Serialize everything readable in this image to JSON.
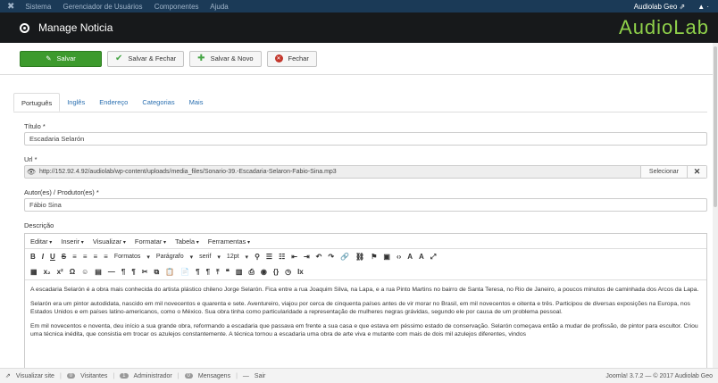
{
  "topnav": {
    "menu": [
      "Sistema",
      "Gerenciador de Usuários",
      "Componentes",
      "Ajuda"
    ],
    "user": "Audiolab Geo ⇗",
    "user2": "▲ ·"
  },
  "header": {
    "title": "Manage Noticia",
    "brand": "AudioLab"
  },
  "toolbar": {
    "save": "Salvar",
    "save_close": "Salvar & Fechar",
    "save_new": "Salvar & Novo",
    "close": "Fechar"
  },
  "tabs": [
    "Português",
    "Inglês",
    "Endereço",
    "Categorias",
    "Mais"
  ],
  "form": {
    "titulo_label": "Título *",
    "titulo_value": "Escadaria Selarón",
    "url_label": "Url *",
    "url_value": "http://152.92.4.92/audiolab/wp-content/uploads/media_files/Sonario-39.-Escadaria-Selaron-Fabio-Sina.mp3",
    "select_label": "Selecionar",
    "autor_label": "Autor(es) / Produtor(es) *",
    "autor_value": "Fábio Sina",
    "descricao_label": "Descrição"
  },
  "editor": {
    "menu": [
      "Editar",
      "Inserir",
      "Visualizar",
      "Formatar",
      "Tabela",
      "Ferramentas"
    ],
    "formats": "Formatos",
    "paragraph": "Parágrafo",
    "font": "serif",
    "size": "12pt",
    "paragraphs": [
      "A escadaria Selarón é a obra mais conhecida do artista plástico chileno Jorge Selarón. Fica entre a rua Joaquim Silva, na Lapa, e a rua Pinto Martins no bairro de Santa Teresa, no Rio de Janeiro, a poucos minutos de caminhada dos Arcos da Lapa.",
      "Selarón era um pintor autodidata, nascido em mil novecentos e quarenta e sete. Aventureiro, viajou por cerca de cinquenta países antes de vir morar no Brasil, em mil novecentos e oitenta e três. Participou de diversas exposições na Europa, nos Estados Unidos e em países latino-americanos, como o México. Sua obra tinha como particularidade a representação de mulheres negras grávidas, segundo ele por causa de um problema pessoal.",
      "Em mil novecentos e noventa, deu início a sua grande obra, reformando a escadaria que passava em frente a sua casa e que estava em péssimo estado de conservação. Selarón começava então a mudar de profissão, de pintor para escultor. Criou uma técnica inédita, que consistia em trocar os azulejos constantemente. A técnica tornou a escadaria uma obra de arte viva e mutante com mais de dois mil azulejos diferentes, vindos"
    ]
  },
  "status": {
    "view_site": "Visualizar site",
    "visitors_count": "0",
    "visitors": "Visitantes",
    "admin_count": "1",
    "admin": "Administrador",
    "messages_count": "0",
    "messages": "Mensagens",
    "logout": "Sair",
    "version": "Joomla! 3.7.2 — © 2017 Audiolab Geo"
  },
  "colors": {
    "topnav": "#1b3a57",
    "header": "#17191b",
    "brand": "#8fd14a",
    "save": "#3d9a2d",
    "link": "#2a6fb0"
  }
}
